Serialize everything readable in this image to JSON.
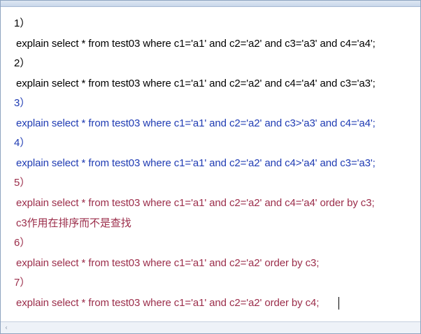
{
  "editor": {
    "lines": [
      {
        "text": "1）",
        "color": "#000000"
      },
      {
        "text": "explain select * from test03 where c1='a1' and c2='a2' and c3='a3' and c4='a4';",
        "color": "#000000"
      },
      {
        "text": "2）",
        "color": "#000000"
      },
      {
        "text": "explain select * from test03 where c1='a1' and c2='a2' and c4='a4' and c3='a3';",
        "color": "#000000"
      },
      {
        "text": "3）",
        "color": "#1f3bb3"
      },
      {
        "text": "explain select * from test03 where c1='a1' and c2='a2' and c3>'a3' and c4='a4';",
        "color": "#1f3bb3"
      },
      {
        "text": "4）",
        "color": "#1f3bb3"
      },
      {
        "text": "explain select * from test03 where c1='a1' and c2='a2' and c4>'a4' and c3='a3';",
        "color": "#1f3bb3"
      },
      {
        "text": "5）",
        "color": "#9b2d4a"
      },
      {
        "text": "explain select * from test03 where c1='a1' and c2='a2' and c4='a4' order by c3;",
        "color": "#9b2d4a"
      },
      {
        "text": "c3作用在排序而不是查找",
        "color": "#9b2d4a"
      },
      {
        "text": "6）",
        "color": "#9b2d4a"
      },
      {
        "text": "explain select * from test03 where c1='a1' and c2='a2' order by c3;",
        "color": "#9b2d4a"
      },
      {
        "text": "7）",
        "color": "#9b2d4a"
      },
      {
        "text": "explain select * from test03 where c1='a1' and c2='a2' order by c4;",
        "color": "#9b2d4a"
      }
    ]
  },
  "scrollbar": {
    "left_arrow": "‹"
  }
}
